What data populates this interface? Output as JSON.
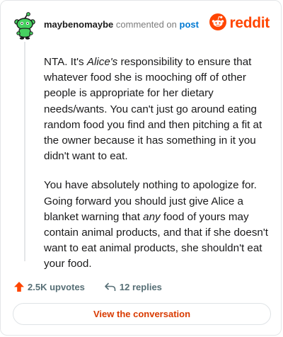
{
  "comment": {
    "username": "maybenomaybe",
    "action_text": "commented on",
    "post_link": "post",
    "paragraphs": [
      [
        {
          "text": "NTA. It's ",
          "italic": false
        },
        {
          "text": "Alice's",
          "italic": true
        },
        {
          "text": " responsibility to ensure that whatever food she is mooching off of other people is appropriate for her dietary needs/wants. You can't just go around eating random food you find and then pitching a fit at the owner because it has something in it you didn't want to eat.",
          "italic": false
        }
      ],
      [
        {
          "text": "You have absolutely nothing to apologize for. Going forward you should just give Alice a blanket warning that ",
          "italic": false
        },
        {
          "text": "any",
          "italic": true
        },
        {
          "text": " food of yours may contain animal products, and that if she doesn't want to eat animal products, she shouldn't eat your food.",
          "italic": false
        }
      ]
    ]
  },
  "brand": {
    "wordmark": "reddit",
    "color": "#ff4500"
  },
  "footer": {
    "upvotes_label": "2.5K upvotes",
    "replies_label": "12 replies",
    "cta_label": "View the conversation"
  },
  "colors": {
    "accent": "#ff4500",
    "link": "#0079d3",
    "cta_text": "#d93a00",
    "muted": "#576f76",
    "snoo_green": "#46d160"
  },
  "icons": {
    "avatar": "snoo-avatar-icon",
    "brand_logo": "reddit-logo-icon",
    "upvote": "upvote-arrow-icon",
    "reply": "reply-arrow-icon"
  }
}
